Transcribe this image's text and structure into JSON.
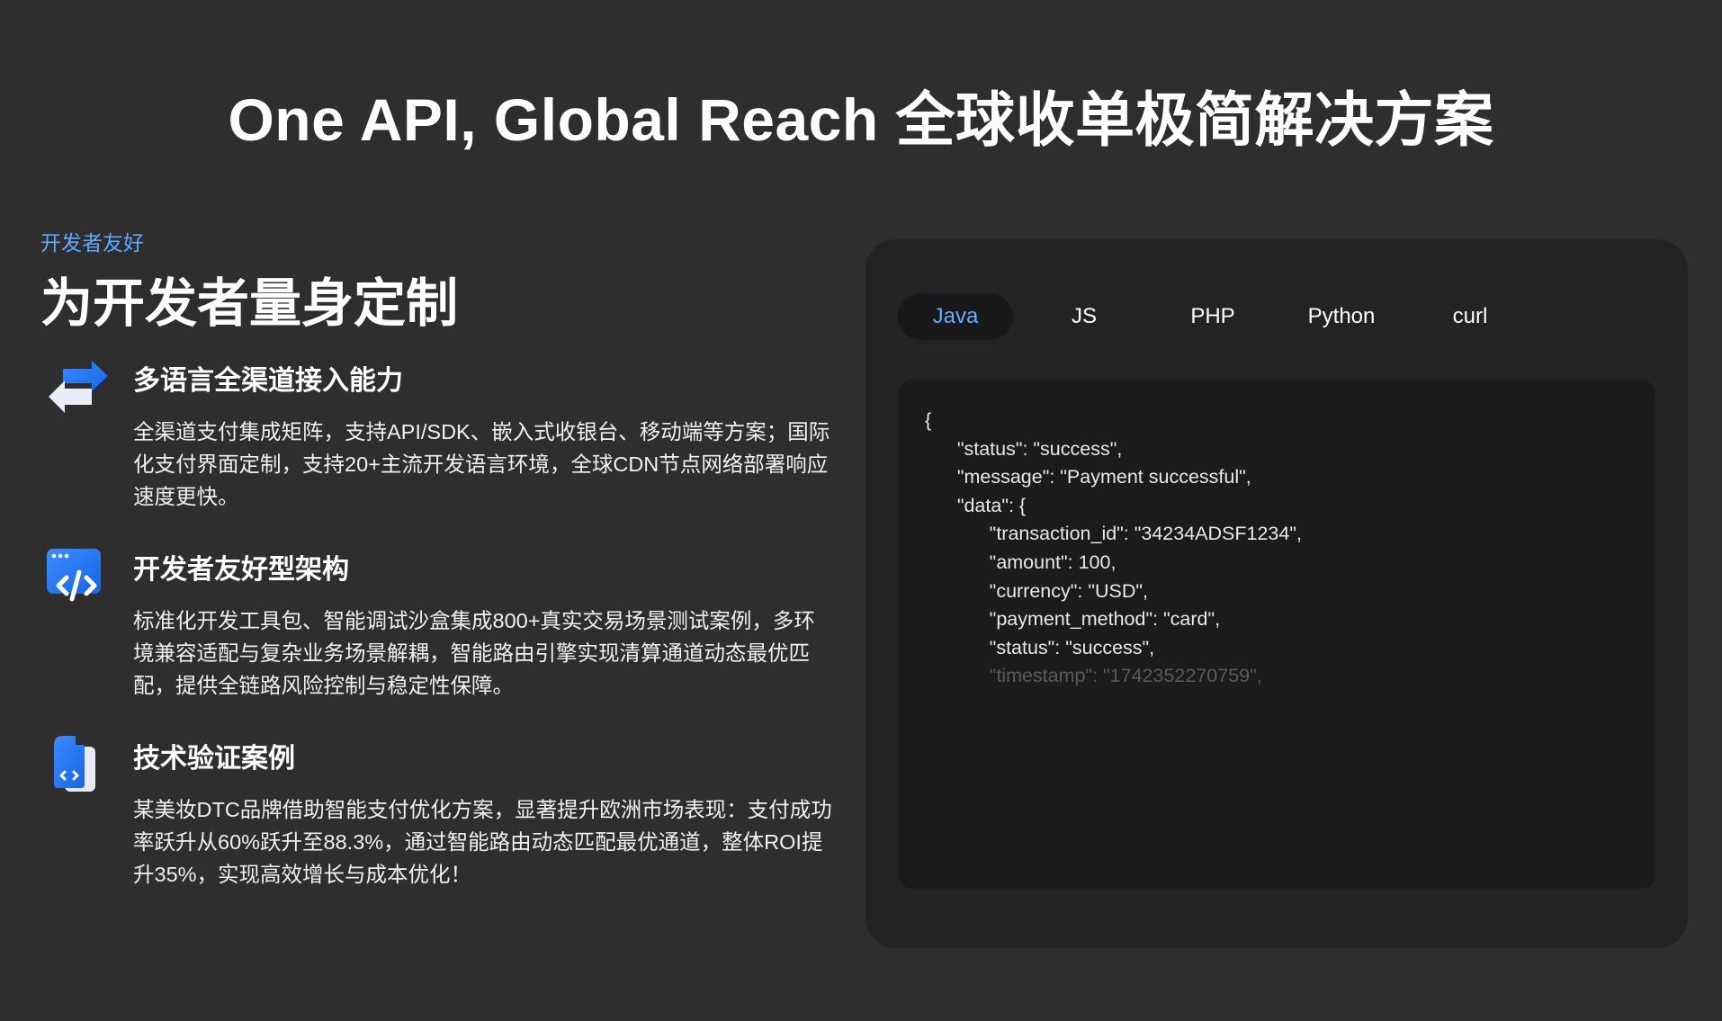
{
  "title": "One API, Global Reach 全球收单极简解决方案",
  "left": {
    "eyebrow": "开发者友好",
    "heading": "为开发者量身定制",
    "features": [
      {
        "icon": "arrows-exchange-icon",
        "title": "多语言全渠道接入能力",
        "desc": "全渠道支付集成矩阵，支持API/SDK、嵌入式收银台、移动端等方案；国际化支付界面定制，支持20+主流开发语言环境，全球CDN节点网络部署响应速度更快。"
      },
      {
        "icon": "code-window-icon",
        "title": "开发者友好型架构",
        "desc": "标准化开发工具包、智能调试沙盒集成800+真实交易场景测试案例，多环境兼容适配与复杂业务场景解耦，智能路由引擎实现清算通道动态最优匹配，提供全链路风险控制与稳定性保障。"
      },
      {
        "icon": "code-document-icon",
        "title": "技术验证案例",
        "desc": "某美妆DTC品牌借助智能支付优化方案，显著提升欧洲市场表现：支付成功率跃升从60%跃升至88.3%，通过智能路由动态匹配最优通道，整体ROI提升35%，实现高效增长与成本优化！"
      }
    ]
  },
  "code_panel": {
    "tabs": [
      "Java",
      "JS",
      "PHP",
      "Python",
      "curl"
    ],
    "active_tab": "Java",
    "code_lines": [
      "{",
      "      \"status\": \"success\",",
      "      \"message\": \"Payment successful\",",
      "      \"data\": {",
      "            \"transaction_id\": \"34234ADSF1234\",",
      "            \"amount\": 100,",
      "            \"currency\": \"USD\",",
      "            \"payment_method\": \"card\",",
      "            \"status\": \"success\","
    ],
    "faded_line": "            \"timestamp\": \"1742352270759\","
  },
  "colors": {
    "background": "#2e2e2f",
    "panel": "#232325",
    "code_bg": "#1b1b1d",
    "accent": "#5fa8ff"
  }
}
